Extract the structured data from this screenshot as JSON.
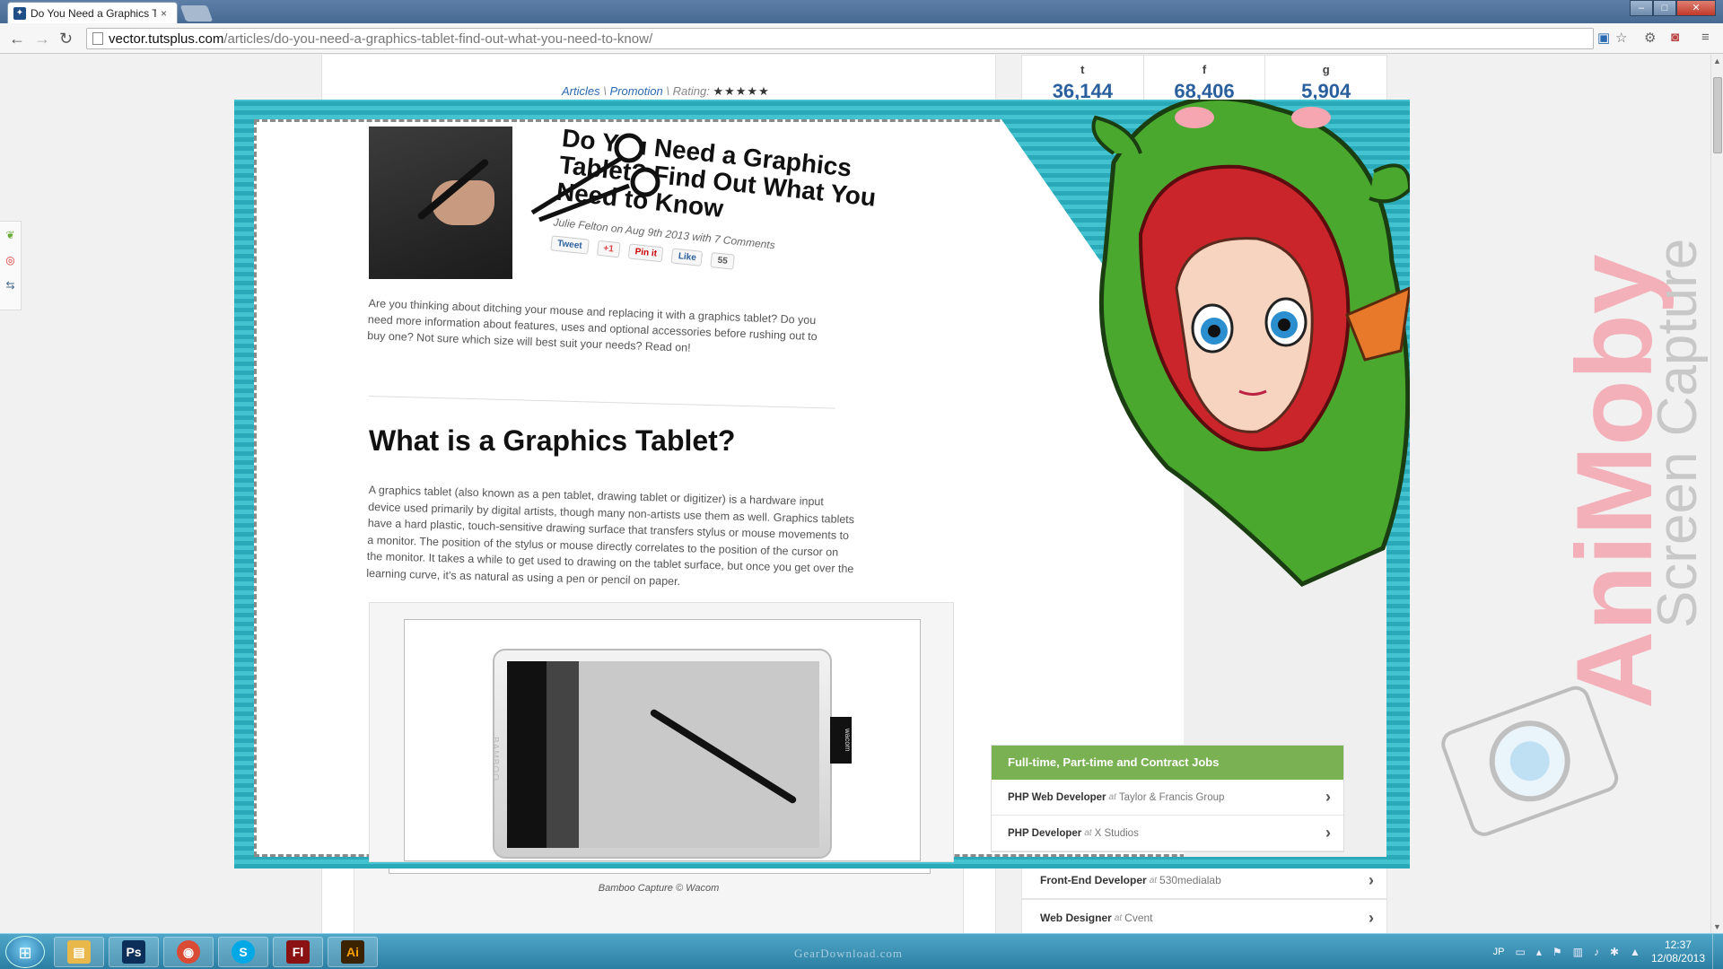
{
  "browser": {
    "tab_title": "Do You Need a Graphics T",
    "tab_close": "×",
    "url_host": "vector.tutsplus.com",
    "url_path": "/articles/do-you-need-a-graphics-tablet-find-out-what-you-need-to-know/",
    "back": "←",
    "forward": "→",
    "reload": "↻",
    "menu": "≡",
    "star": "☆",
    "window_controls": [
      "–",
      "□",
      "✕"
    ]
  },
  "breadcrumb": {
    "articles": "Articles",
    "sep": "\\",
    "promotion": "Promotion",
    "rating_label": "Rating:",
    "stars": "★★★★★"
  },
  "social": [
    {
      "icon": "twitter-icon",
      "glyph": "t",
      "count": "36,144"
    },
    {
      "icon": "facebook-icon",
      "glyph": "f",
      "count": "68,406"
    },
    {
      "icon": "googleplus-icon",
      "glyph": "g",
      "count": "5,904"
    }
  ],
  "article": {
    "title": "Do You Need a Graphics Tablet? Find Out What You Need to Know",
    "byline": "Julie Felton on Aug 9th 2013 with 7 Comments",
    "share": {
      "tweet": "Tweet",
      "gplus": "+1",
      "pin": "Pin it",
      "like": "Like",
      "like_count": "55"
    },
    "intro": "Are you thinking about ditching your mouse and replacing it with a graphics tablet? Do you need more information about features, uses and optional accessories before rushing out to buy one? Not sure which size will best suit your needs? Read on!",
    "section_heading": "What is a Graphics Tablet?",
    "section_body": "A graphics tablet (also known as a pen tablet, drawing tablet or digitizer) is a hardware input device used primarily by digital artists, though many non-artists use them as well. Graphics tablets have a hard plastic, touch-sensitive drawing surface that transfers stylus or mouse movements to a monitor. The position of the stylus or mouse directly correlates to the position of the cursor on the monitor. It takes a while to get used to drawing on the tablet surface, but once you get over the learning curve, it's as natural as using a pen or pencil on paper.",
    "image_caption": "Bamboo Capture © Wacom",
    "tablet_brand": "BAMBOO",
    "tablet_tab": "wacom"
  },
  "jobs": {
    "heading": "Full-time, Part-time and Contract Jobs",
    "at": "at",
    "chev": "›",
    "rows": [
      {
        "title": "PHP Web Developer",
        "company": "Taylor & Francis Group"
      },
      {
        "title": "PHP Developer",
        "company": "X Studios"
      },
      {
        "title": "Front-End Developer",
        "company": "530medialab"
      },
      {
        "title": "Web Designer",
        "company": "Cvent"
      }
    ]
  },
  "overlay": {
    "brand_line1": "AniMoby",
    "brand_line2": "Screen Capture",
    "colors": {
      "teal": "#2aa9b8",
      "green": "#4aa82e",
      "hair": "#c9252b",
      "brand_pink": "#f3b0b8"
    }
  },
  "taskbar": {
    "apps": [
      {
        "name": "explorer",
        "glyph": "▤",
        "color": "#e8b94a"
      },
      {
        "name": "photoshop",
        "glyph": "Ps",
        "color": "#0c2f5a"
      },
      {
        "name": "chrome",
        "glyph": "◉",
        "color": "#d94b35"
      },
      {
        "name": "skype",
        "glyph": "S",
        "color": "#00a8e6"
      },
      {
        "name": "flash",
        "glyph": "Fl",
        "color": "#8a1212"
      },
      {
        "name": "illustrator",
        "glyph": "Ai",
        "color": "#3b2300"
      }
    ],
    "watermark": "GearDownload.com",
    "lang": "JP",
    "time": "12:37",
    "date": "12/08/2013"
  }
}
